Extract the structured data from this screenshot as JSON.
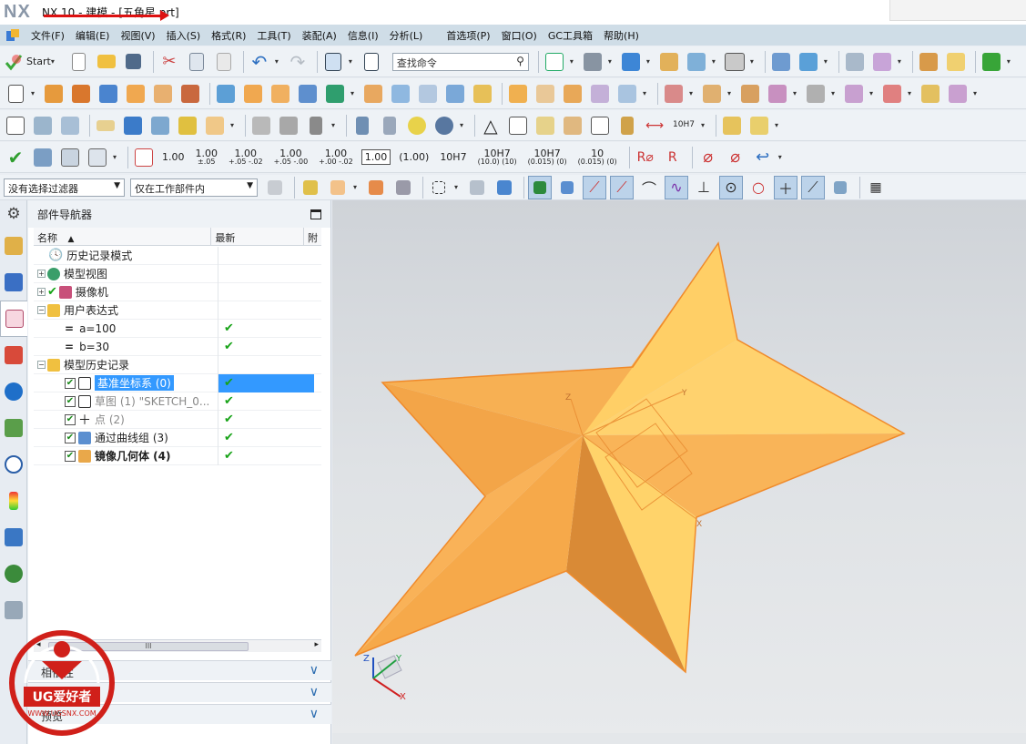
{
  "window": {
    "logo": "NX",
    "title": "NX 10 - 建模 - [五角星.prt]"
  },
  "menu": [
    "文件(F)",
    "编辑(E)",
    "视图(V)",
    "插入(S)",
    "格式(R)",
    "工具(T)",
    "装配(A)",
    "信息(I)",
    "分析(L)",
    "首选项(P)",
    "窗口(O)",
    "GC工具箱",
    "帮助(H)"
  ],
  "toolbar": {
    "start_label": "Start",
    "search_placeholder": "查找命令",
    "dimension_labels": [
      {
        "main": "1.00",
        "sub": ""
      },
      {
        "main": "1.00",
        "sub": "±.05"
      },
      {
        "main": "1.00",
        "sub": "+.05 -.02"
      },
      {
        "main": "1.00",
        "sub": "+.05 -.00"
      },
      {
        "main": "1.00",
        "sub": "+.00 -.02"
      }
    ],
    "boxed_label": "1.00",
    "paren_label": "(1.00)",
    "fit_labels": [
      {
        "main": "10H7",
        "sub": ""
      },
      {
        "main": "10H7",
        "sub": "(10.0) (10)"
      },
      {
        "main": "10H7",
        "sub": "(0.015) (0)"
      },
      {
        "main": "10",
        "sub": "(0.015) (0)"
      }
    ],
    "fit_drop_label": "10H7"
  },
  "filters": {
    "selection_filter": "没有选择过滤器",
    "scope_filter": "仅在工作部件内"
  },
  "navigator": {
    "title": "部件导航器",
    "col_name": "名称",
    "col_latest": "最新",
    "col_extra": "附",
    "rows": [
      {
        "label": "历史记录模式",
        "latest": ""
      },
      {
        "label": "模型视图",
        "latest": ""
      },
      {
        "label": "摄像机",
        "latest": ""
      },
      {
        "label": "用户表达式",
        "latest": ""
      },
      {
        "label": "a=100",
        "latest": "✔"
      },
      {
        "label": "b=30",
        "latest": "✔"
      },
      {
        "label": "模型历史记录",
        "latest": ""
      },
      {
        "label": "基准坐标系 (0)",
        "latest": "✔"
      },
      {
        "label": "草图 (1) \"SKETCH_0...",
        "latest": "✔"
      },
      {
        "label": "点 (2)",
        "latest": "✔"
      },
      {
        "label": "通过曲线组 (3)",
        "latest": "✔"
      },
      {
        "label": "镜像几何体 (4)",
        "latest": "✔"
      }
    ],
    "panels": [
      "相依性",
      "细节",
      "预览"
    ]
  },
  "viewport": {
    "star_color_light": "#ffd168",
    "star_color_mid": "#f6a94a",
    "star_color_dark": "#d98a36",
    "axis_labels": {
      "x": "X",
      "y": "Y",
      "z": "Z"
    }
  },
  "watermark": {
    "brand": "UG爱好者",
    "url": "WWW.UGSNX.COM"
  }
}
